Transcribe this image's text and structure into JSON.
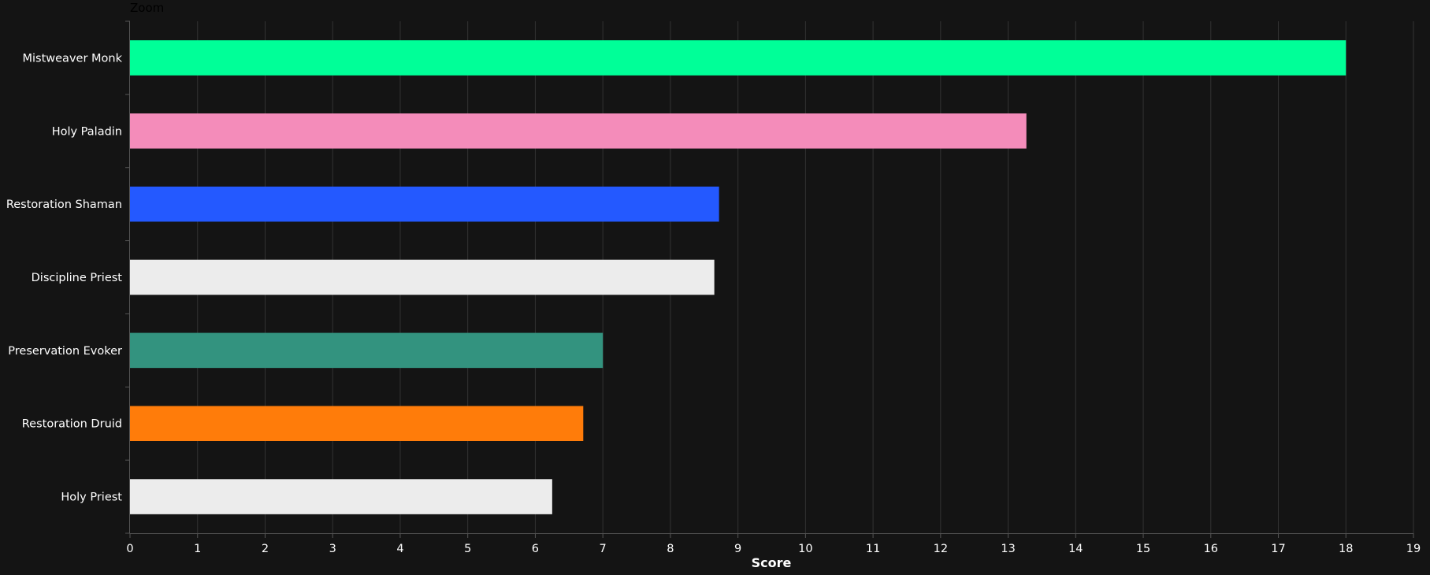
{
  "zoom_label": "Zoom",
  "chart_data": {
    "type": "bar",
    "orientation": "horizontal",
    "categories": [
      "Mistweaver Monk",
      "Holy Paladin",
      "Restoration Shaman",
      "Discipline Priest",
      "Preservation Evoker",
      "Restoration Druid",
      "Holy Priest"
    ],
    "values": [
      18.0,
      13.27,
      8.72,
      8.65,
      7.0,
      6.71,
      6.25
    ],
    "colors": [
      "#00ff98",
      "#f48cba",
      "#2459ff",
      "#ececec",
      "#33937f",
      "#ff7c0a",
      "#ececec"
    ],
    "xlabel": "Score",
    "ylabel": "",
    "xlim": [
      0,
      19
    ],
    "xticks": [
      0,
      1,
      2,
      3,
      4,
      5,
      6,
      7,
      8,
      9,
      10,
      11,
      12,
      13,
      14,
      15,
      16,
      17,
      18,
      19
    ],
    "grid": true,
    "background": "#141414",
    "grid_color": "#333333"
  }
}
